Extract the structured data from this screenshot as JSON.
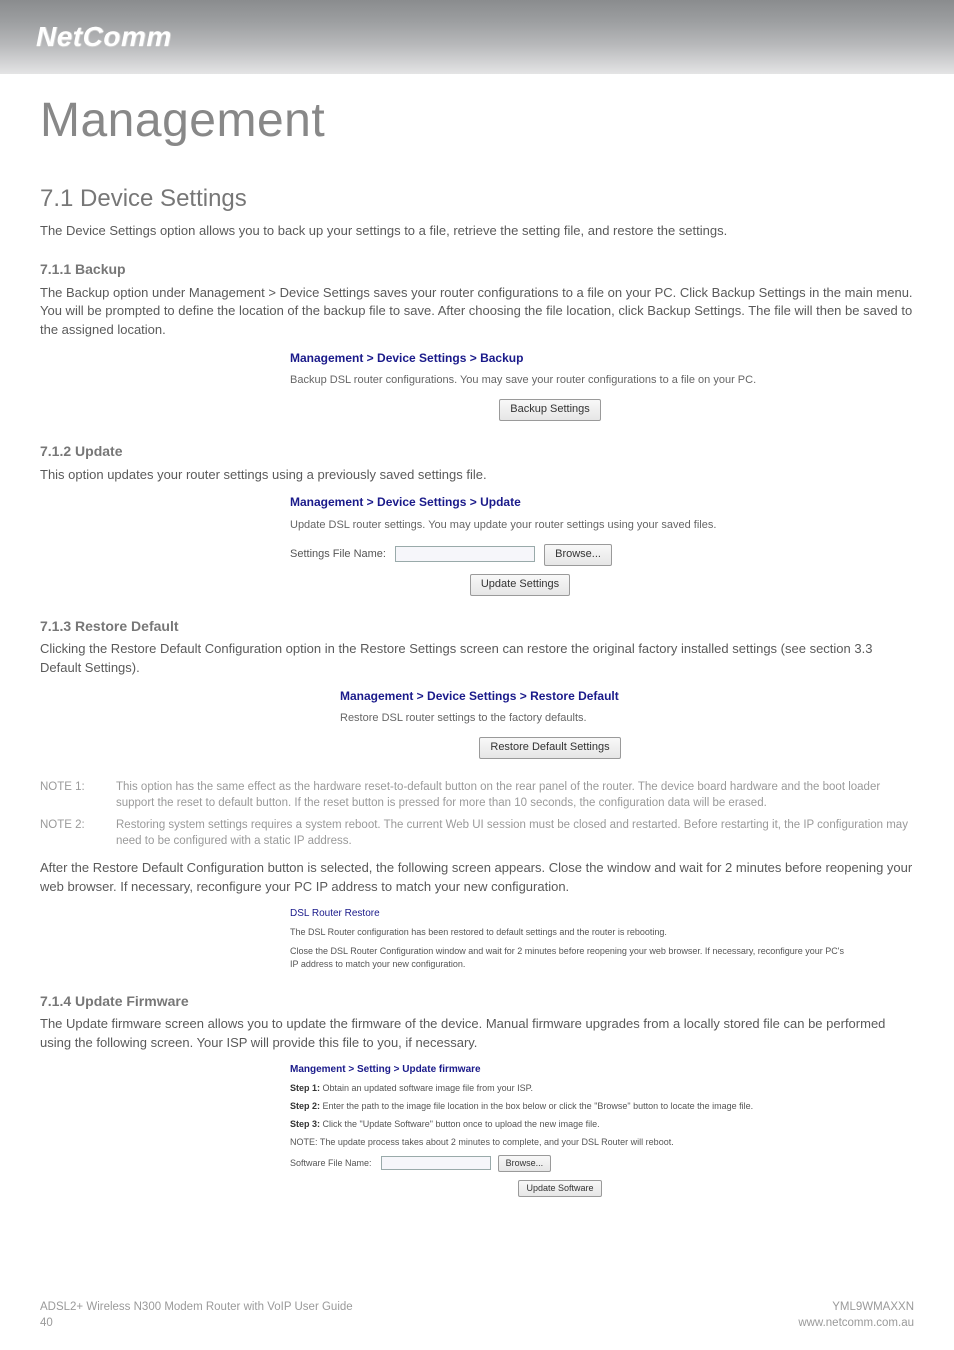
{
  "brand": "NetComm",
  "title": "Management",
  "section": "7.1 Device Settings",
  "section_intro": "The Device Settings option allows you to back up your settings to a file, retrieve the setting file, and restore the settings.",
  "backup": {
    "heading": "7.1.1   Backup",
    "para": "The Backup option under Management > Device Settings saves your router configurations to a file on your PC.  Click Backup Settings in the main menu. You will be prompted to define the location of the backup file to save.  After choosing the file location, click Backup Settings.  The file will then be saved to the assigned location.",
    "shot": {
      "head": "Management > Device Settings > Backup",
      "desc": "Backup DSL router configurations. You may save your router configurations to a file on your PC.",
      "button": "Backup Settings"
    }
  },
  "update": {
    "heading": "7.1.2   Update",
    "para": "This option updates your router settings using a previously saved settings file.",
    "shot": {
      "head": "Management > Device Settings > Update",
      "desc": "Update DSL router settings. You may update your router settings using your saved files.",
      "file_label": "Settings File Name:",
      "browse": "Browse...",
      "button": "Update Settings"
    }
  },
  "restore": {
    "heading": "7.1.3   Restore Default",
    "para": "Clicking the Restore Default Configuration option in the Restore Settings screen can restore the original factory installed settings (see section 3.3 Default Settings).",
    "shot": {
      "head": "Management > Device Settings > Restore Default",
      "desc": "Restore DSL router settings to the factory defaults.",
      "button": "Restore Default Settings"
    },
    "note1_label": "NOTE 1:",
    "note1": "This option has the same effect as the hardware reset-to-default button on the rear panel of the router.  The device board hardware and the boot loader support the reset to default button.  If the reset button is pressed for more than 10 seconds, the configuration data will be erased.",
    "note2_label": "NOTE 2:",
    "note2": "Restoring system settings requires a system reboot.  The current Web UI session must be closed and restarted.  Before restarting it, the IP configuration may need to be configured with a static IP address.",
    "after_para": "After the Restore Default Configuration button is selected, the following screen appears. Close the window and wait for 2 minutes before reopening your web browser. If necessary, reconfigure your PC IP address to match your new configuration.",
    "reboot_shot": {
      "head": "DSL Router Restore",
      "line1": "The DSL Router configuration has been restored to default settings and the router is rebooting.",
      "line2": "Close the DSL Router Configuration window and wait for 2 minutes before reopening your web browser. If necessary, reconfigure your PC's IP address to match your new configuration."
    }
  },
  "firmware": {
    "heading": "7.1.4 Update Firmware",
    "para": "The Update firmware screen allows you to update the firmware of the device.  Manual firmware upgrades from a locally stored file can be performed using the following screen.  Your ISP will provide this file to you, if necessary.",
    "shot": {
      "head": "Mangement > Setting > Update firmware",
      "step1": "Obtain an updated software image file from your ISP.",
      "step1_label": "Step 1:",
      "step2": "Enter the path to the image file location in the box below or click the \"Browse\" button to locate the image file.",
      "step2_label": "Step 2:",
      "step3": "Click the \"Update Software\" button once to upload the new image file.",
      "step3_label": "Step 3:",
      "note": "NOTE: The update process takes about 2 minutes to complete, and your DSL Router will reboot.",
      "file_label": "Software File Name:",
      "browse": "Browse...",
      "button": "Update Software"
    }
  },
  "footer": {
    "left1": "ADSL2+ Wireless N300 Modem Router with VoIP User Guide",
    "left2": "40",
    "right1": "YML9WMAXXN",
    "right2": "www.netcomm.com.au"
  }
}
